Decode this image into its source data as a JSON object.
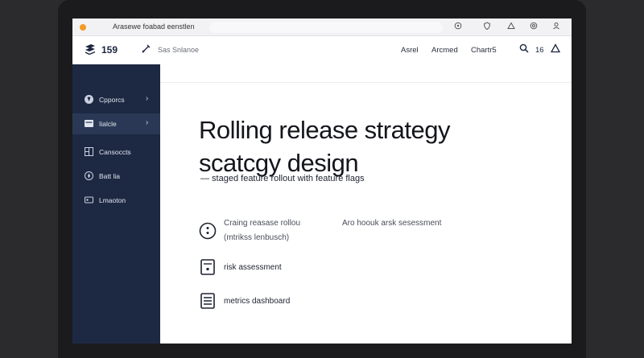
{
  "browser": {
    "tab_title": "Arasewe foabad eenstlen"
  },
  "header": {
    "logo_text": "159",
    "crumb_text": "Sas Snlanoe",
    "nav": [
      "Asrel",
      "Arcmed",
      "Chartr5"
    ],
    "count": "16"
  },
  "sidebar": {
    "items": [
      {
        "label": "Cpporcs",
        "icon": "circle-icon",
        "chevron": true,
        "active": false
      },
      {
        "label": "Iialcle",
        "icon": "window-icon",
        "chevron": true,
        "active": true
      },
      {
        "label": "Cansoccts",
        "icon": "grid-icon",
        "chevron": false,
        "active": false
      },
      {
        "label": "Batt lia",
        "icon": "compass-icon",
        "chevron": false,
        "active": false
      },
      {
        "label": "Lmaoton",
        "icon": "card-icon",
        "chevron": false,
        "active": false
      }
    ]
  },
  "main": {
    "title_line1": "Rolling release strategy",
    "title_line2": "scatcgy design",
    "subtitle": "— staged feature rollout with feature flags",
    "features": [
      {
        "icon": "info-circle-icon",
        "line1": "Craing reasase rollou",
        "line2": "(mtrikss lenbusch)",
        "extra": "Aro hoouk arsk sesessment"
      },
      {
        "icon": "document-icon",
        "line1": "risk assessment"
      },
      {
        "icon": "list-document-icon",
        "line1": "metrics dashboard"
      }
    ]
  },
  "colors": {
    "sidebar_bg": "#1d2942",
    "sidebar_active": "#2b3855",
    "accent_dot": "#f59a23"
  }
}
